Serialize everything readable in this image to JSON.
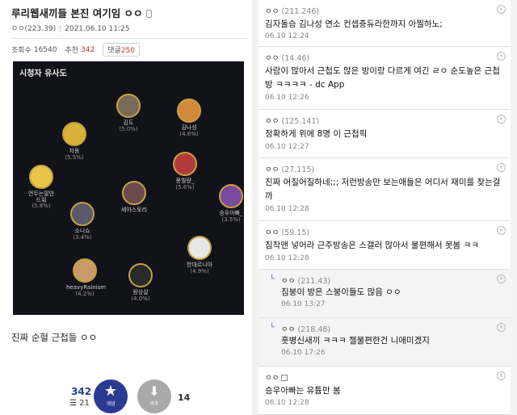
{
  "post": {
    "title": "루리웹새끼들 본진 여기임 ㅇㅇ",
    "author": "ㅇㅇ(223.39)",
    "date": "2021.06.10 11:25",
    "views_label": "조회수",
    "views": "16540",
    "recommend_label": "추천",
    "recommend": "342",
    "comments_label": "댓글",
    "comments": "250",
    "body": "진짜 순혈 근첩들 ㅇㅇ"
  },
  "viz": {
    "title": "시청자 유사도",
    "nodes": [
      {
        "name": "김도",
        "pct": "(5.0%)",
        "color": "#7a6a55"
      },
      {
        "name": "김나성",
        "pct": "(4.6%)",
        "color": "#d08a3a"
      },
      {
        "name": "자동",
        "pct": "(5.5%)",
        "color": "#d9b23a"
      },
      {
        "name": "풍월량_",
        "pct": "(5.6%)",
        "color": "#b33a3a"
      },
      {
        "name": "연두는말안\n드뤄",
        "pct": "(5.8%)",
        "color": "#e8c64a"
      },
      {
        "name": "세아스토리",
        "pct": "",
        "color": "#6a4a4a"
      },
      {
        "name": "승우아빠_",
        "pct": "(3.5%)",
        "color": "#7a4aa0"
      },
      {
        "name": "소니쇼",
        "pct": "(3.4%)",
        "color": "#5a5a6a"
      },
      {
        "name": "한대르니아",
        "pct": "(4.9%)",
        "color": "#e8e8e8"
      },
      {
        "name": "heavyRainism",
        "pct": "(4.2%)",
        "color": "#c89a6a"
      },
      {
        "name": "왕상살",
        "pct": "(4.0%)",
        "color": "#2a2a2a"
      }
    ]
  },
  "vote": {
    "up": "342",
    "fixed": "21",
    "up_label": "개념",
    "down_label": "비추",
    "down": "14"
  },
  "comments": [
    {
      "nick": "ㅇㅇ",
      "ip": "(211.246)",
      "text": "김자돌승 김나성 연소 컨셉충듀라한까지 아찔하노;",
      "date": "06.10 12:24",
      "reply": false
    },
    {
      "nick": "ㅇㅇ",
      "ip": "(14.46)",
      "text": "사람이 많아서 근첩도 많은 방이랑 다르게 여긴 ㄹㅇ 순도높은 근첩방 ㅋㅋㅋㅋ - dc App",
      "date": "06.10 12:26",
      "reply": false
    },
    {
      "nick": "ㅇㅇ",
      "ip": "(125.141)",
      "text": "정확하게 위에 8명 이 근첩픽",
      "date": "06.10 12:27",
      "reply": false
    },
    {
      "nick": "ㅇㅇ",
      "ip": "(27.115)",
      "text": "진짜 어질어질하네;;; 저런방송만 보는애들은 어디서 재미를 찾는걸까",
      "date": "06.10 12:28",
      "reply": false
    },
    {
      "nick": "ㅇㅇ",
      "ip": "(59.15)",
      "text": "침착맨 넣어라 근주방송은 스갤러 많아서 불편해서 못봄 ㅋㅋ",
      "date": "06.10 12:28",
      "reply": false
    },
    {
      "nick": "ㅇㅇ",
      "ip": "(211.43)",
      "text": "침붕이 방은 스붕이들도 많음 ㅇㅇ",
      "date": "06.10 13:27",
      "reply": true
    },
    {
      "nick": "ㅇㅇ",
      "ip": "(218.48)",
      "text": "훗병신새끼 ㅋㅋㅋ 젤불편한건 니애미겠지",
      "date": "06.10 17:26",
      "reply": true
    },
    {
      "nick": "ㅇㅇ",
      "ip": "",
      "text": "승우아빠는 유튭만 봄",
      "date": "06.10 12:28",
      "reply": false
    }
  ]
}
